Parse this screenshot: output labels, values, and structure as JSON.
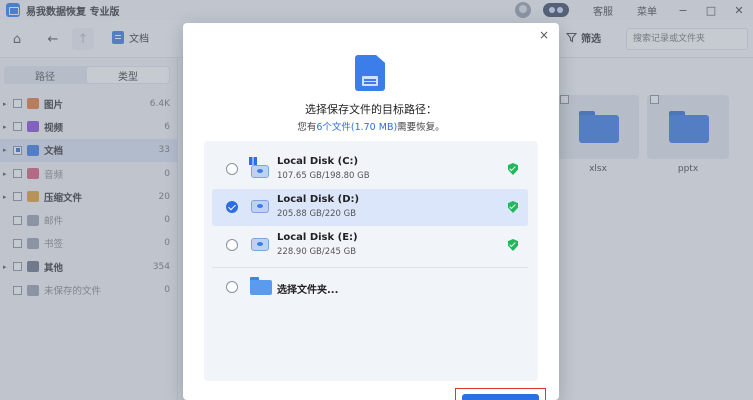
{
  "app": {
    "title": "易我数据恢复 专业版"
  },
  "titlebar": {
    "service": "客服",
    "menu": "菜单",
    "minimize": "−",
    "maximize": "□",
    "close": "✕"
  },
  "toolbar": {
    "home": "⌂",
    "back": "←",
    "up": "↑",
    "breadcrumb": "文档",
    "filter": "筛选",
    "search_placeholder": "搜索记录或文件夹"
  },
  "sidebar": {
    "tabs": [
      "路径",
      "类型"
    ],
    "active_tab": "类型",
    "items": [
      {
        "label": "图片",
        "count": "6.4K",
        "color": "#e7793a",
        "expandable": true,
        "dim": false
      },
      {
        "label": "视频",
        "count": "6",
        "color": "#8c4de0",
        "expandable": true,
        "dim": false
      },
      {
        "label": "文档",
        "count": "33",
        "color": "#3b7de9",
        "expandable": true,
        "dim": false,
        "selected": true
      },
      {
        "label": "音频",
        "count": "0",
        "color": "#e05a7a",
        "expandable": true,
        "dim": true
      },
      {
        "label": "压缩文件",
        "count": "20",
        "color": "#e6a22a",
        "expandable": true,
        "dim": false
      },
      {
        "label": "邮件",
        "count": "0",
        "color": "#9aa3b2",
        "expandable": false,
        "dim": true
      },
      {
        "label": "书签",
        "count": "0",
        "color": "#9aa3b2",
        "expandable": false,
        "dim": true
      },
      {
        "label": "其他",
        "count": "354",
        "color": "#6b7688",
        "expandable": true,
        "dim": false
      },
      {
        "label": "未保存的文件",
        "count": "0",
        "color": "#9aa3b2",
        "expandable": false,
        "dim": true
      }
    ]
  },
  "content": {
    "files": [
      {
        "name": "xlsx"
      },
      {
        "name": "pptx"
      }
    ]
  },
  "dialog": {
    "title": "选择保存文件的目标路径：",
    "subtitle_prefix": "您有",
    "subtitle_highlight": "6个文件(1.70 MB)",
    "subtitle_suffix": "需要恢复。",
    "close": "×",
    "disks": [
      {
        "name": "Local Disk (C:)",
        "size": "107.65 GB/198.80 GB",
        "selected": false
      },
      {
        "name": "Local Disk (D:)",
        "size": "205.88 GB/220 GB",
        "selected": true
      },
      {
        "name": "Local Disk (E:)",
        "size": "228.90 GB/245 GB",
        "selected": false
      }
    ],
    "choose_folder": "选择文件夹..."
  }
}
